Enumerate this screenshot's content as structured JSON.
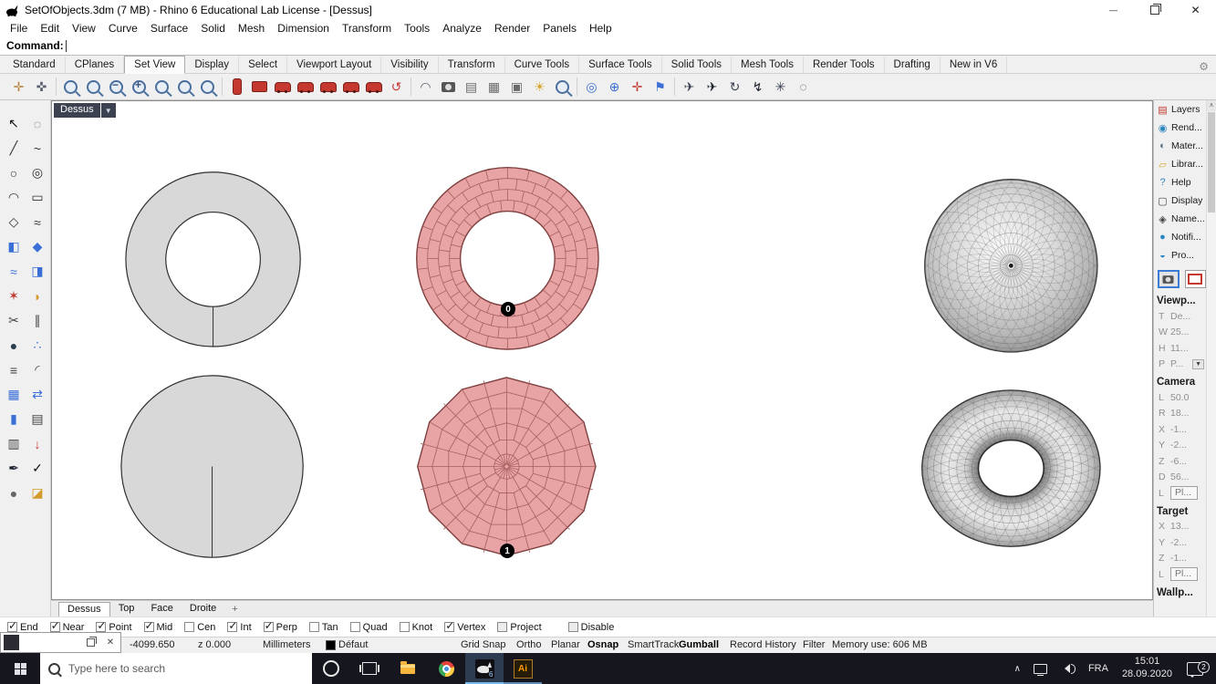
{
  "window": {
    "title": "SetOfObjects.3dm (7 MB) - Rhino 6 Educational Lab License - [Dessus]"
  },
  "menu": {
    "items": [
      "File",
      "Edit",
      "View",
      "Curve",
      "Surface",
      "Solid",
      "Mesh",
      "Dimension",
      "Transform",
      "Tools",
      "Analyze",
      "Render",
      "Panels",
      "Help"
    ]
  },
  "command": {
    "label": "Command:",
    "value": ""
  },
  "tabs": {
    "active": "Set View",
    "items": [
      "Standard",
      "CPlanes",
      "Set View",
      "Display",
      "Select",
      "Viewport Layout",
      "Visibility",
      "Transform",
      "Curve Tools",
      "Surface Tools",
      "Solid Tools",
      "Mesh Tools",
      "Render Tools",
      "Drafting",
      "New in V6"
    ]
  },
  "top_toolbar": {
    "icons": [
      {
        "name": "pan-view-icon",
        "kind": "glyph",
        "glyph": "✛",
        "color": "#b5853f"
      },
      {
        "name": "move-view-icon",
        "kind": "glyph",
        "glyph": "✜",
        "color": "#5a6170"
      },
      {
        "name": "zoom-dynamic-icon",
        "kind": "mag"
      },
      {
        "name": "zoom-window-icon",
        "kind": "mag"
      },
      {
        "name": "zoom-out-icon",
        "kind": "mag-minus"
      },
      {
        "name": "zoom-in-icon",
        "kind": "mag-plus"
      },
      {
        "name": "zoom-extents-icon",
        "kind": "mag"
      },
      {
        "name": "zoom-extents-all-icon",
        "kind": "mag"
      },
      {
        "name": "zoom-selected-icon",
        "kind": "mag"
      },
      {
        "name": "set-view-plan-icon",
        "kind": "redpill"
      },
      {
        "name": "set-view-camera-icon",
        "kind": "redcam"
      },
      {
        "name": "set-view-top-icon",
        "kind": "redcar"
      },
      {
        "name": "set-view-bottom-icon",
        "kind": "redcar"
      },
      {
        "name": "set-view-left-icon",
        "kind": "redcar"
      },
      {
        "name": "set-view-right-icon",
        "kind": "redcar"
      },
      {
        "name": "set-view-front-icon",
        "kind": "redcar"
      },
      {
        "name": "rotate-view-icon",
        "kind": "glyph",
        "glyph": "↺",
        "color": "#c23b36"
      },
      {
        "name": "tilt-view-icon",
        "kind": "glyph",
        "glyph": "◠",
        "color": "#5a6170"
      },
      {
        "name": "camera-settings-icon",
        "kind": "cam"
      },
      {
        "name": "named-views-icon",
        "kind": "glyph",
        "glyph": "▤",
        "color": "#6a6a6a"
      },
      {
        "name": "viewport-layout-icon",
        "kind": "glyph",
        "glyph": "▦",
        "color": "#6a6a6a"
      },
      {
        "name": "print-preview-icon",
        "kind": "glyph",
        "glyph": "▣",
        "color": "#6a6a6a"
      },
      {
        "name": "sun-light-icon",
        "kind": "glyph",
        "glyph": "☀",
        "color": "#d8a62c"
      },
      {
        "name": "magnifier-icon",
        "kind": "mag"
      },
      {
        "name": "target-view-icon",
        "kind": "glyph",
        "glyph": "◎",
        "color": "#3a6fd8"
      },
      {
        "name": "crosshair-icon",
        "kind": "glyph",
        "glyph": "⊕",
        "color": "#3a6fd8"
      },
      {
        "name": "place-target-icon",
        "kind": "glyph",
        "glyph": "✛",
        "color": "#c23b36"
      },
      {
        "name": "flag-icon",
        "kind": "glyph",
        "glyph": "⚑",
        "color": "#3a6fd8"
      },
      {
        "name": "fly-view-icon",
        "kind": "glyph",
        "glyph": "✈",
        "color": "#3a4150"
      },
      {
        "name": "fly-view-alt-icon",
        "kind": "glyph",
        "glyph": "✈",
        "color": "#181f2a"
      },
      {
        "name": "turntable-icon",
        "kind": "glyph",
        "glyph": "↻",
        "color": "#3a4150"
      },
      {
        "name": "walkabout-icon",
        "kind": "glyph",
        "glyph": "↯",
        "color": "#181f2a"
      },
      {
        "name": "spotlight-icon",
        "kind": "glyph",
        "glyph": "✳",
        "color": "#3a4150"
      },
      {
        "name": "orbit-dots-icon",
        "kind": "glyph",
        "glyph": "◌",
        "color": "#3a4150"
      }
    ]
  },
  "palette": {
    "icons": [
      {
        "name": "select-arrow-icon",
        "glyph": "↖",
        "color": "#101010"
      },
      {
        "name": "lasso-select-icon",
        "glyph": "◌",
        "color": "#555555"
      },
      {
        "name": "polyline-icon",
        "glyph": "╱",
        "color": "#333333"
      },
      {
        "name": "control-point-curve-icon",
        "glyph": "~",
        "color": "#333333"
      },
      {
        "name": "circle-icon",
        "glyph": "○",
        "color": "#333333"
      },
      {
        "name": "ellipse-icon",
        "glyph": "◎",
        "color": "#333333"
      },
      {
        "name": "arc-icon",
        "glyph": "◠",
        "color": "#333333"
      },
      {
        "name": "rectangle-icon",
        "glyph": "▭",
        "color": "#333333"
      },
      {
        "name": "polygon-icon",
        "glyph": "◇",
        "color": "#333333"
      },
      {
        "name": "freeform-curve-icon",
        "glyph": "≈",
        "color": "#333333"
      },
      {
        "name": "surface-plane-icon",
        "glyph": "◧",
        "color": "#3a6fd8"
      },
      {
        "name": "surface-corner-points-icon",
        "glyph": "◆",
        "color": "#3a6fd8"
      },
      {
        "name": "loft-icon",
        "glyph": "≈",
        "color": "#3a6fd8"
      },
      {
        "name": "extrude-icon",
        "glyph": "◨",
        "color": "#3a6fd8"
      },
      {
        "name": "sweep-icon",
        "glyph": "✶",
        "color": "#c0392b"
      },
      {
        "name": "revolve-icon",
        "glyph": "◗",
        "color": "#d39b2c"
      },
      {
        "name": "trim-icon",
        "glyph": "✂",
        "color": "#444444"
      },
      {
        "name": "split-icon",
        "glyph": "∥",
        "color": "#444444"
      },
      {
        "name": "boolean-union-icon",
        "glyph": "●",
        "color": "#2c3e50"
      },
      {
        "name": "point-cloud-icon",
        "glyph": "∴",
        "color": "#3a6fd8"
      },
      {
        "name": "offset-curve-icon",
        "glyph": "≡",
        "color": "#444444"
      },
      {
        "name": "fillet-corner-icon",
        "glyph": "◜",
        "color": "#444444"
      },
      {
        "name": "array-icon",
        "glyph": "▦",
        "color": "#3a6fd8"
      },
      {
        "name": "mirror-icon",
        "glyph": "⇄",
        "color": "#3a6fd8"
      },
      {
        "name": "cylinder-icon",
        "glyph": "▮",
        "color": "#3a6fd8"
      },
      {
        "name": "hatch-icon",
        "glyph": "▤",
        "color": "#444444"
      },
      {
        "name": "grid-icon",
        "glyph": "▥",
        "color": "#444444"
      },
      {
        "name": "pin-point-icon",
        "glyph": "↓",
        "color": "#c23b36"
      },
      {
        "name": "annotate-pen-icon",
        "glyph": "✒",
        "color": "#1a2230"
      },
      {
        "name": "check-icon",
        "glyph": "✓",
        "color": "#101010"
      },
      {
        "name": "sphere-tool-icon",
        "glyph": "●",
        "color": "#666666"
      },
      {
        "name": "eraser-icon",
        "glyph": "◪",
        "color": "#d39b2c"
      }
    ]
  },
  "viewport": {
    "label": "Dessus",
    "badge0": "0",
    "badge1": "1"
  },
  "right_panel": {
    "panels": [
      {
        "label": "Layers",
        "icon_name": "layers-icon",
        "glyph": "▤",
        "color": "#c0392b"
      },
      {
        "label": "Rend...",
        "icon_name": "rendering-icon",
        "glyph": "◉",
        "color": "#2e86c1"
      },
      {
        "label": "Mater...",
        "icon_name": "materials-icon",
        "glyph": "◐",
        "color": "#5d6d7e"
      },
      {
        "label": "Librar...",
        "icon_name": "libraries-icon",
        "glyph": "▱",
        "color": "#d8a62c"
      },
      {
        "label": "Help",
        "icon_name": "help-icon",
        "glyph": "?",
        "color": "#2e86c1"
      },
      {
        "label": "Display",
        "icon_name": "display-icon",
        "glyph": "▢",
        "color": "#444444"
      },
      {
        "label": "Name...",
        "icon_name": "named-views-panel-icon",
        "glyph": "◈",
        "color": "#444444"
      },
      {
        "label": "Notifi...",
        "icon_name": "notifications-icon",
        "glyph": "●",
        "color": "#2e86c1"
      },
      {
        "label": "Pro...",
        "icon_name": "properties-icon",
        "glyph": "◒",
        "color": "#2e86c1"
      }
    ],
    "sections": [
      {
        "header": "Viewp...",
        "rows": [
          {
            "k": "T",
            "v": "De..."
          },
          {
            "k": "W",
            "v": "25..."
          },
          {
            "k": "H",
            "v": "11..."
          },
          {
            "k": "P",
            "v": "P...",
            "dropdown": true
          }
        ]
      },
      {
        "header": "Camera",
        "rows": [
          {
            "k": "L",
            "v": "50.0"
          },
          {
            "k": "R",
            "v": "18..."
          },
          {
            "k": "X",
            "v": "-1..."
          },
          {
            "k": "Y",
            "v": "-2..."
          },
          {
            "k": "Z",
            "v": "-6..."
          },
          {
            "k": "D",
            "v": "56..."
          },
          {
            "k": "L",
            "v": "Pl...",
            "button": true
          }
        ]
      },
      {
        "header": "Target",
        "rows": [
          {
            "k": "X",
            "v": "13..."
          },
          {
            "k": "Y",
            "v": "-2..."
          },
          {
            "k": "Z",
            "v": "-1..."
          },
          {
            "k": "L",
            "v": "Pl...",
            "button": true
          }
        ]
      },
      {
        "header": "Wallp...",
        "rows": []
      }
    ]
  },
  "viewport_tabs": {
    "active": "Dessus",
    "items": [
      "Dessus",
      "Top",
      "Face",
      "Droite"
    ]
  },
  "osnap": {
    "items": [
      {
        "label": "End",
        "checked": true
      },
      {
        "label": "Near",
        "checked": true
      },
      {
        "label": "Point",
        "checked": true
      },
      {
        "label": "Mid",
        "checked": true
      },
      {
        "label": "Cen",
        "checked": false
      },
      {
        "label": "Int",
        "checked": true
      },
      {
        "label": "Perp",
        "checked": true
      },
      {
        "label": "Tan",
        "checked": false
      },
      {
        "label": "Quad",
        "checked": false
      },
      {
        "label": "Knot",
        "checked": false
      },
      {
        "label": "Vertex",
        "checked": true
      },
      {
        "label": "Project",
        "checked": false,
        "dim": true
      },
      {
        "label": "Disable",
        "checked": false,
        "dim": true,
        "gap": true
      }
    ]
  },
  "status_bar": {
    "fields": [
      {
        "name": "coordinate-x",
        "text": "-4099.650"
      },
      {
        "name": "coordinate-z",
        "text": "z 0.000"
      },
      {
        "name": "units",
        "text": "Millimeters"
      },
      {
        "name": "active-layer",
        "text": "Défaut",
        "swatch": true
      },
      {
        "name": "grid-snap-pane",
        "text": "Grid Snap"
      },
      {
        "name": "ortho-pane",
        "text": "Ortho"
      },
      {
        "name": "planar-pane",
        "text": "Planar"
      },
      {
        "name": "osnap-pane",
        "text": "Osnap",
        "bold": true
      },
      {
        "name": "smarttrack-pane",
        "text": "SmartTrack"
      },
      {
        "name": "gumball-pane",
        "text": "Gumball",
        "bold": true
      },
      {
        "name": "record-history-pane",
        "text": "Record History"
      },
      {
        "name": "filter-pane",
        "text": "Filter"
      },
      {
        "name": "memory-use",
        "text": "Memory use: 606 MB"
      }
    ]
  },
  "taskbar": {
    "search": {
      "placeholder": "Type here to search"
    },
    "apps": [
      {
        "name": "cortana"
      },
      {
        "name": "task-view"
      },
      {
        "name": "file-explorer"
      },
      {
        "name": "chrome"
      },
      {
        "name": "rhino",
        "active": true,
        "badge": "6"
      },
      {
        "name": "illustrator",
        "open": true,
        "label": "Ai"
      }
    ],
    "tray": {
      "language": "FRA",
      "time": "15:01",
      "date": "28.09.2020",
      "notifications": "2"
    }
  }
}
